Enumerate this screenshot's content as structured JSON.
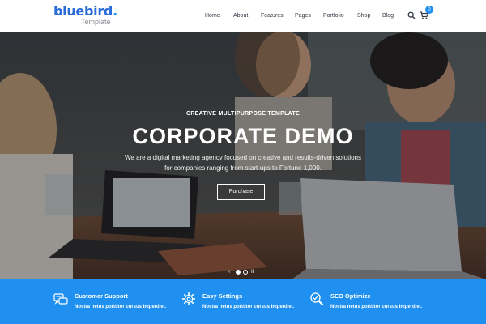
{
  "brand": {
    "logo_text": "bluebird",
    "logo_dot": ".",
    "logo_subtitle": "Template"
  },
  "nav": {
    "items": [
      {
        "label": "Home"
      },
      {
        "label": "About"
      },
      {
        "label": "Features"
      },
      {
        "label": "Pages"
      },
      {
        "label": "Portfolio"
      },
      {
        "label": "Shop"
      },
      {
        "label": "Blog"
      }
    ],
    "cart_count": "0"
  },
  "hero": {
    "kicker": "CREATIVE MULTIPURPOSE TEMPLATE",
    "title": "CORPORATE DEMO",
    "subtitle_line1": "We are a digital marketing agency focused on creative and results-driven solutions",
    "subtitle_line2": "for companies ranging from start-ups to Fortune 1,000.",
    "button_label": "Purchase"
  },
  "slider": {
    "prev_label": "‹",
    "pause_label": "II",
    "active_index": 1,
    "dot_count": 2
  },
  "features": [
    {
      "title": "Customer Support",
      "text": "Nostra netus porttitor cursus Imperdiet.",
      "icon": "chat-support-icon"
    },
    {
      "title": "Easy Settings",
      "text": "Nostra netus porttitor cursus Imperdiet.",
      "icon": "settings-gear-icon"
    },
    {
      "title": "SEO Optimize",
      "text": "Nostra netus porttitor cursus Imperdiet.",
      "icon": "seo-magnifier-icon"
    }
  ],
  "colors": {
    "brand_blue": "#2a6bd8",
    "accent_blue": "#1f90ef",
    "white": "#ffffff"
  }
}
